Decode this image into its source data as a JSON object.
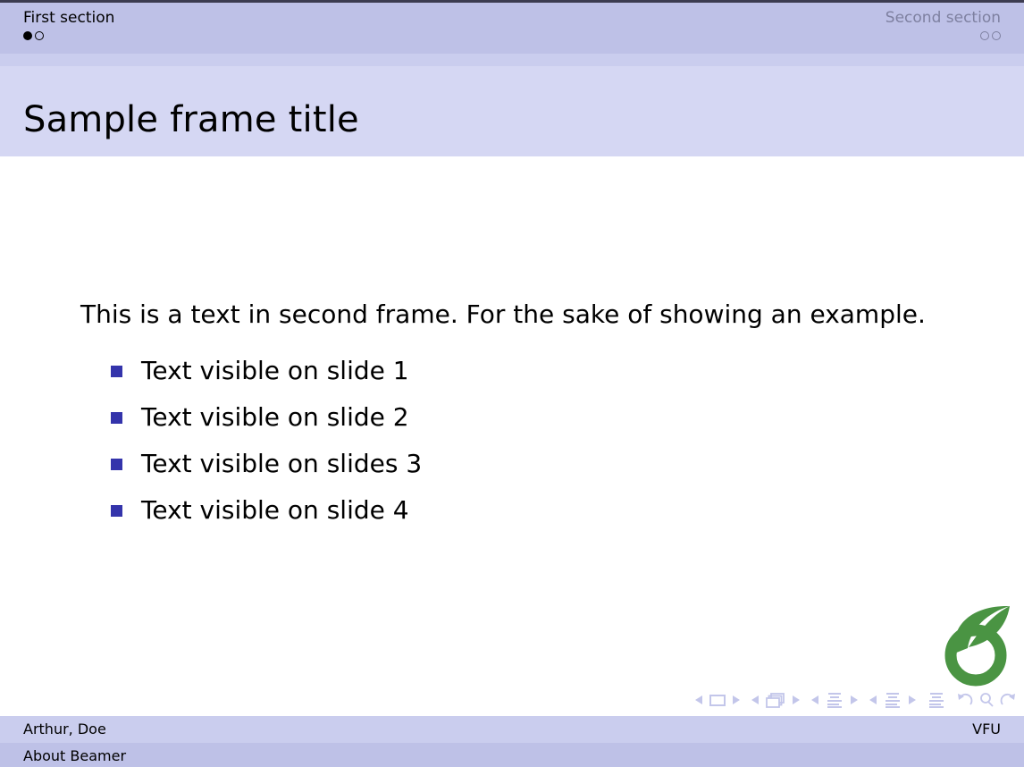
{
  "theme": {
    "nav_bar_color": "#bec1e7",
    "nav_separator_color": "#cacdee",
    "title_bar_color": "#d5d7f3",
    "body_color": "#ffffff",
    "bullet_color": "#3434ab",
    "inactive_text_color": "#7e80a0",
    "logo_color": "#4a9443",
    "nav_symbol_color": "#c3c6ea",
    "top_border_color": "#3c3c50"
  },
  "navigation": {
    "sections": [
      {
        "label": "First section",
        "active": true,
        "slides": [
          {
            "state": "filled"
          },
          {
            "state": "hollow"
          }
        ]
      },
      {
        "label": "Second section",
        "active": false,
        "slides": [
          {
            "state": "hollow"
          },
          {
            "state": "hollow"
          }
        ]
      }
    ]
  },
  "frame": {
    "title": "Sample frame title"
  },
  "content": {
    "lead_paragraph": "This is a text in second frame.  For the sake of showing an example.",
    "items": [
      {
        "label": "Text visible on slide 1"
      },
      {
        "label": "Text visible on slide 2"
      },
      {
        "label": "Text visible on slides 3"
      },
      {
        "label": "Text visible on slide 4"
      }
    ]
  },
  "logo": {
    "name": "sprout-logo"
  },
  "nav_symbols": {
    "groups": [
      {
        "name": "slide",
        "icons": [
          "prev-triangle-icon",
          "slide-icon",
          "next-triangle-icon"
        ]
      },
      {
        "name": "frame",
        "icons": [
          "prev-triangle-icon",
          "frame-icon",
          "next-triangle-icon"
        ]
      },
      {
        "name": "subsection",
        "icons": [
          "prev-triangle-icon",
          "subsection-icon",
          "next-triangle-icon"
        ]
      },
      {
        "name": "section",
        "icons": [
          "prev-triangle-icon",
          "section-icon",
          "next-triangle-icon"
        ]
      },
      {
        "name": "presentation",
        "icons": [
          "presentation-icon"
        ]
      },
      {
        "name": "history",
        "icons": [
          "back-icon",
          "search-icon",
          "forward-icon"
        ]
      }
    ]
  },
  "footer": {
    "author": "Arthur, Doe",
    "institute": "VFU",
    "short_title": "About Beamer"
  }
}
